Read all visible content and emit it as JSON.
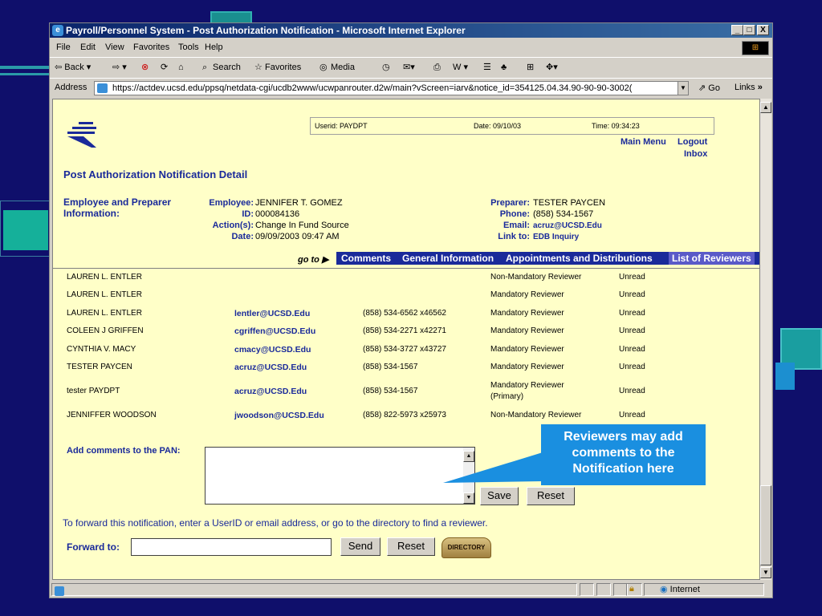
{
  "window": {
    "title": "Payroll/Personnel System - Post Authorization Notification - Microsoft Internet Explorer",
    "controls": [
      "_",
      "□",
      "X"
    ]
  },
  "menu": [
    "File",
    "Edit",
    "View",
    "Favorites",
    "Tools",
    "Help"
  ],
  "toolbar": {
    "back": "⇦ Back ▾",
    "forward": "⇨ ▾",
    "stop": "⊗",
    "refresh": "⟳",
    "home": "⌂",
    "search": "Search",
    "favorites": "Favorites",
    "media": "Media",
    "history": "◷",
    "mail": "✉▾",
    "print": "⎙",
    "edit": "W ▾",
    "discuss": "☰",
    "messenger": "♣",
    "research": "⊞",
    "extra": "✥▾"
  },
  "address": {
    "label": "Address",
    "url": "https://actdev.ucsd.edu/ppsq/netdata-cgi/ucdb2www/ucwpanrouter.d2w/main?vScreen=iarv&notice_id=354125.04.34.90-90-90-3002(",
    "go": "Go",
    "links": "Links"
  },
  "header": {
    "userid": "Userid: PAYDPT",
    "date": "Date: 09/10/03",
    "time": "Time: 09:34:23",
    "main_menu": "Main Menu",
    "logout": "Logout",
    "inbox": "Inbox"
  },
  "page_title": "Post Authorization Notification Detail",
  "employee_section": {
    "label_line1": "Employee and Preparer",
    "label_line2": "Information:",
    "employee_k": "Employee:",
    "employee_v": "JENNIFER T. GOMEZ",
    "id_k": "ID:",
    "id_v": "000084136",
    "actions_k": "Action(s):",
    "actions_v": "Change In Fund Source",
    "date_k": "Date:",
    "date_v": "09/09/2003 09:47 AM",
    "preparer_k": "Preparer:",
    "preparer_v": "TESTER PAYCEN",
    "phone_k": "Phone:",
    "phone_v": "(858) 534-1567",
    "email_k": "Email:",
    "email_v": "acruz@UCSD.Edu",
    "linkto_k": "Link to:",
    "linkto_v": "EDB Inquiry"
  },
  "nav": {
    "goto": "go to",
    "tabs": [
      "Comments",
      "General Information",
      "Appointments and Distributions",
      "List of Reviewers"
    ]
  },
  "reviewers": [
    {
      "name": "LAUREN L. ENTLER",
      "email": "",
      "phone": "",
      "role": "Non-Mandatory Reviewer",
      "status": "Unread"
    },
    {
      "name": "LAUREN L. ENTLER",
      "email": "",
      "phone": "",
      "role": "Mandatory Reviewer",
      "status": "Unread"
    },
    {
      "name": "LAUREN L. ENTLER",
      "email": "lentler@UCSD.Edu",
      "phone": "(858) 534-6562 x46562",
      "role": "Mandatory Reviewer",
      "status": "Unread"
    },
    {
      "name": "COLEEN J GRIFFEN",
      "email": "cgriffen@UCSD.Edu",
      "phone": "(858) 534-2271 x42271",
      "role": "Mandatory Reviewer",
      "status": "Unread"
    },
    {
      "name": "CYNTHIA V. MACY",
      "email": "cmacy@UCSD.Edu",
      "phone": "(858) 534-3727 x43727",
      "role": "Mandatory Reviewer",
      "status": "Unread"
    },
    {
      "name": "TESTER PAYCEN",
      "email": "acruz@UCSD.Edu",
      "phone": "(858) 534-1567",
      "role": "Mandatory Reviewer",
      "status": "Unread"
    },
    {
      "name": "tester PAYDPT",
      "email": "acruz@UCSD.Edu",
      "phone": "(858) 534-1567",
      "role": "Mandatory Reviewer",
      "role2": "(Primary)",
      "status": "Unread"
    },
    {
      "name": "JENNIFFER WOODSON",
      "email": "jwoodson@UCSD.Edu",
      "phone": "(858) 822-5973 x25973",
      "role": "Non-Mandatory Reviewer",
      "status": "Unread"
    }
  ],
  "comments": {
    "label": "Add comments to the PAN:",
    "save": "Save",
    "reset": "Reset"
  },
  "forward": {
    "instructions": "To forward this notification, enter a UserID or email address, or go to the directory to find a reviewer.",
    "label": "Forward to:",
    "value": "",
    "send": "Send",
    "reset": "Reset",
    "directory": "DIRECTORY"
  },
  "callout": {
    "line1": "Reviewers may add",
    "line2": "comments to the",
    "line3": "Notification here",
    "color": "#1a8fe0"
  },
  "status": {
    "zone": "Internet"
  }
}
